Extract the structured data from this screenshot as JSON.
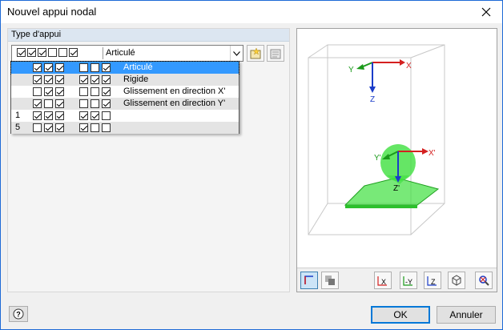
{
  "window": {
    "title": "Nouvel appui nodal"
  },
  "support_type": {
    "header": "Type d'appui",
    "selected_checks": [
      true,
      true,
      true,
      false,
      false,
      true
    ],
    "selected_label": "Articulé"
  },
  "dropdown": {
    "items": [
      {
        "num": "",
        "g1": [
          true,
          true,
          true
        ],
        "g2": [
          false,
          false,
          true
        ],
        "label": "Articulé",
        "selected": true
      },
      {
        "num": "",
        "g1": [
          true,
          true,
          true
        ],
        "g2": [
          true,
          true,
          true
        ],
        "label": "Rigide",
        "selected": false
      },
      {
        "num": "",
        "g1": [
          false,
          true,
          true
        ],
        "g2": [
          false,
          false,
          true
        ],
        "label": "Glissement en direction X'",
        "selected": false
      },
      {
        "num": "",
        "g1": [
          true,
          false,
          true
        ],
        "g2": [
          false,
          false,
          true
        ],
        "label": "Glissement en direction Y'",
        "selected": false
      },
      {
        "num": "1",
        "g1": [
          true,
          true,
          true
        ],
        "g2": [
          true,
          true,
          false
        ],
        "label": "",
        "selected": false
      },
      {
        "num": "5",
        "g1": [
          false,
          true,
          true
        ],
        "g2": [
          true,
          false,
          false
        ],
        "label": "",
        "selected": false
      }
    ]
  },
  "preview": {
    "axis_x": "X",
    "axis_y": "Y",
    "axis_z": "Z",
    "axis_xp": "X'",
    "axis_yp": "Y'",
    "axis_zp": "Z'"
  },
  "colors": {
    "accent": "#0078d7",
    "x_axis": "#d42020",
    "y_axis": "#1a9a1a",
    "z_axis": "#1a3cc8",
    "support": "#3ee03e"
  },
  "buttons": {
    "ok": "OK",
    "cancel": "Annuler"
  }
}
